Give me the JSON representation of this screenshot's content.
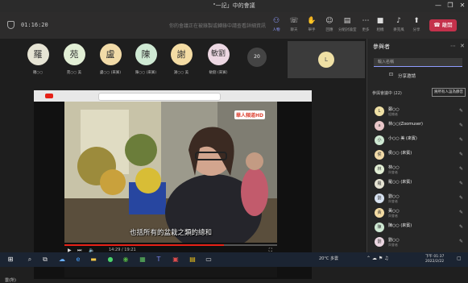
{
  "window": {
    "title": "\"一記」中的會議"
  },
  "meeting": {
    "timer": "01:16:20",
    "notice": "你的會議正在被錄製或轉錄中請查看詳細資訊",
    "tools": [
      {
        "label": "人物",
        "icon": "people-icon"
      },
      {
        "label": "聊天",
        "icon": "chat-icon"
      },
      {
        "label": "舉手",
        "icon": "raise-hand-icon"
      },
      {
        "label": "回應",
        "icon": "react-icon"
      },
      {
        "label": "分組討論室",
        "icon": "rooms-icon"
      },
      {
        "label": "更多",
        "icon": "more-icon"
      },
      {
        "label": "相機",
        "icon": "camera-icon"
      },
      {
        "label": "麥克風",
        "icon": "mic-icon"
      },
      {
        "label": "分享",
        "icon": "share-icon"
      }
    ],
    "leave_label": "離開"
  },
  "stage": {
    "participants": [
      {
        "initial": "羅",
        "name": "羅○○",
        "color": "#e6e4d4"
      },
      {
        "initial": "苑",
        "name": "苑○○ 美",
        "color": "#e2efd5"
      },
      {
        "initial": "盧",
        "name": "盧○○ (來賓)",
        "color": "#f2dba8"
      },
      {
        "initial": "陳",
        "name": "陳○○ (來賓)",
        "color": "#cfe9d3"
      },
      {
        "initial": "謝",
        "name": "謝○○ 美",
        "color": "#f4dca4"
      },
      {
        "initial": "敏劉",
        "name": "敏劉 (來賓)",
        "color": "#ecd7e2"
      }
    ],
    "overflow_count": "20",
    "self_initial": "L",
    "presenter_label": "雲(所)",
    "subtitle": "也括所有的盆栽之類的總和",
    "channel_logo": "華人頻道HD",
    "video_time": "14:29 / 19:21"
  },
  "panel": {
    "title": "參與者",
    "search_placeholder": "輸入名稱",
    "share_invite": "分享邀請",
    "section_label": "參與會議中 (22)",
    "mute_all": "將所有人設為靜音",
    "members": [
      {
        "initial": "L",
        "name": "鄭○○",
        "role": "組織者",
        "color": "#efe0a5"
      },
      {
        "initial": "a",
        "name": "林○○(Zoomuser)",
        "role": "",
        "color": "#e8c6c8"
      },
      {
        "initial": "小",
        "name": "小○○ 美 (來賓)",
        "role": "",
        "color": "#cfe9d3"
      },
      {
        "initial": "侯",
        "name": "侯○○ (來賓)",
        "role": "",
        "color": "#f2dba8"
      },
      {
        "initial": "林",
        "name": "林○○",
        "role": "與會者",
        "color": "#e2efd5"
      },
      {
        "initial": "羅",
        "name": "羅○○ (來賓)",
        "role": "",
        "color": "#e6e4d4"
      },
      {
        "initial": "劉",
        "name": "劉○○",
        "role": "與會者",
        "color": "#d8e3f2"
      },
      {
        "initial": "黃",
        "name": "黃○○",
        "role": "與會者",
        "color": "#f4dca4"
      },
      {
        "initial": "陳",
        "name": "陳○○ (來賓)",
        "role": "",
        "color": "#cfe9d3"
      },
      {
        "initial": "劉",
        "name": "劉○○",
        "role": "與會者",
        "color": "#ecd7e2"
      }
    ]
  },
  "taskbar": {
    "weather": "20°C 多雲",
    "time": "下午 01:37",
    "date": "2022/2/22"
  },
  "colors": {
    "accent": "#8f9cff",
    "leave": "#c4314b",
    "taskbar": "#1b2432"
  }
}
